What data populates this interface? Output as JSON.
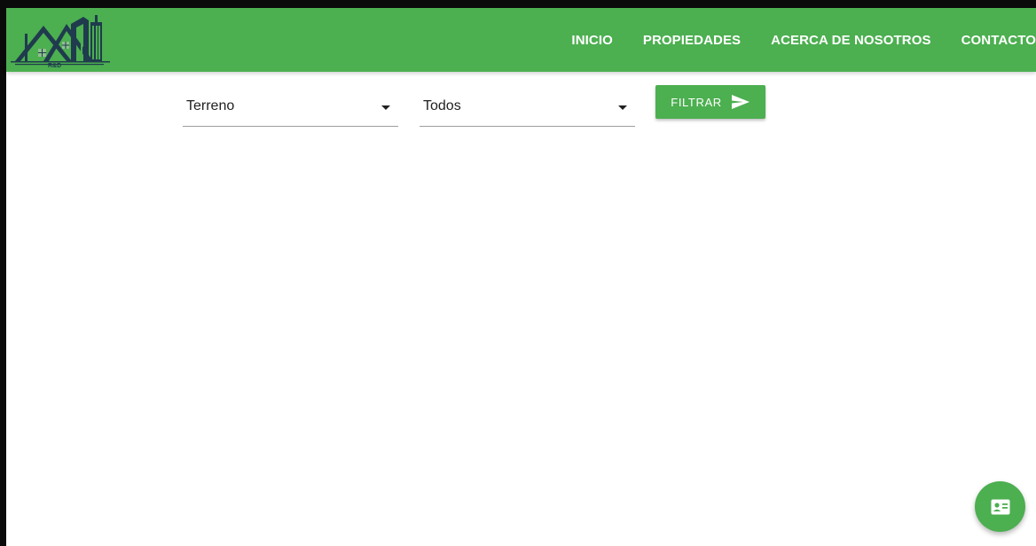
{
  "brand": {
    "logo_text": "R&D",
    "logo_icon": "house-buildings-logo-icon"
  },
  "navbar": {
    "links": [
      "INICIO",
      "PROPIEDADES",
      "ACERCA DE NOSOTROS",
      "CONTACTO"
    ]
  },
  "filters": {
    "type_select": {
      "value": "Terreno"
    },
    "location_select": {
      "value": "Todos"
    },
    "filter_button": {
      "label": "FILTRAR",
      "icon": "send-icon"
    }
  },
  "fab": {
    "icon": "contact-card-icon"
  },
  "colors": {
    "primary": "#4caf50",
    "nav_text": "#ffffff",
    "logo_dark": "#1f3b4d",
    "text": "#212121"
  }
}
